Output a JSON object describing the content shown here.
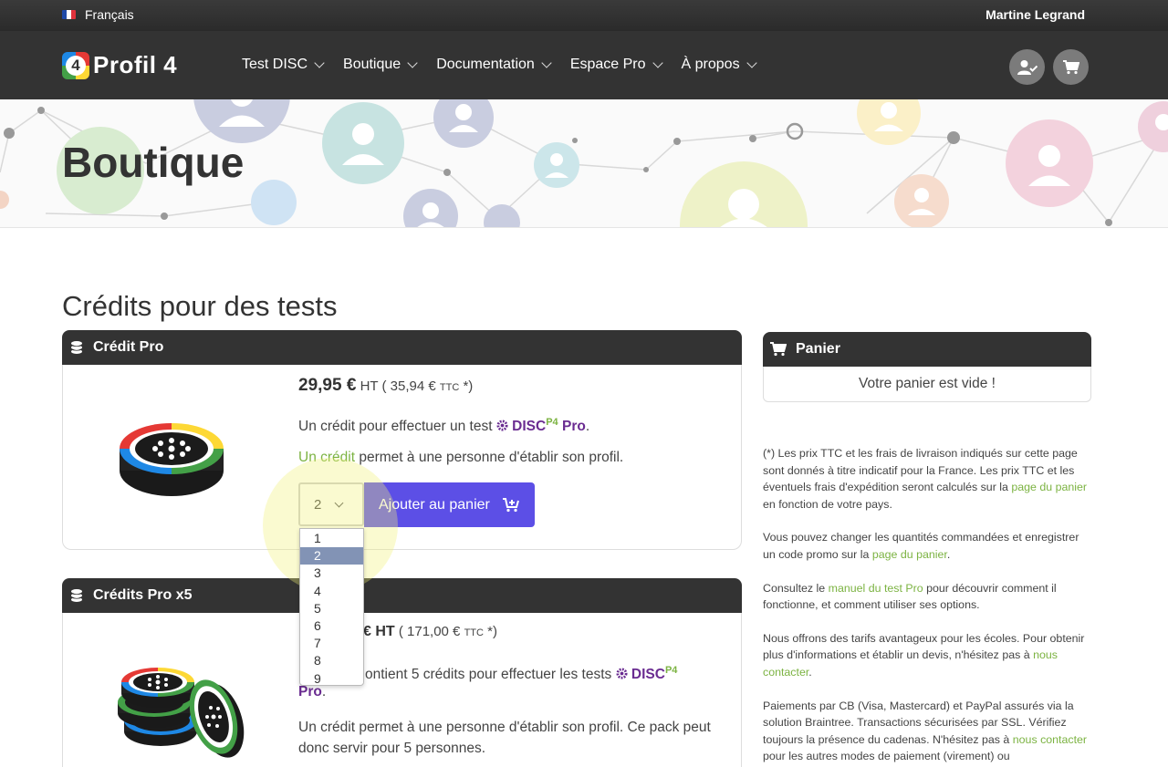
{
  "topbar": {
    "language": "Français",
    "user": "Martine Legrand"
  },
  "brand": {
    "badge": "4",
    "name": "Profil 4"
  },
  "nav": {
    "items": [
      "Test DISC",
      "Boutique",
      "Documentation",
      "Espace Pro",
      "À propos"
    ]
  },
  "hero": {
    "title": "Boutique"
  },
  "section": {
    "title": "Crédits pour des tests"
  },
  "products": [
    {
      "title": "Crédit Pro",
      "price": "29,95 €",
      "price_ht": "HT",
      "price_ttc_open": "( 35,94 €",
      "ttc": "TTC",
      "price_ttc_close": "*)",
      "desc_prefix": "Un crédit pour effectuer un test",
      "brand_disc": "DISC",
      "brand_sup": "P4",
      "brand_pro": "Pro",
      "desc_suffix": ".",
      "credit_link": "Un crédit",
      "credit_text": "permet à une personne d'établir son profil.",
      "qty_selected": "2",
      "add_label": "Ajouter au panier"
    },
    {
      "title": "Crédits Pro x5",
      "price_ht": "€ HT",
      "price_ttc_open": "( 171,00 €",
      "ttc": "TTC",
      "price_ttc_close": "*)",
      "desc_partial": "ontient 5 crédits pour effectuer les tests",
      "brand_disc": "DISC",
      "brand_sup": "P4",
      "brand_pro": "Pro",
      "desc_suffix": ".",
      "credit_text": "Un crédit permet à une personne d'établir son profil. Ce pack peut donc servir pour 5 personnes."
    }
  ],
  "dropdown": {
    "options": [
      "1",
      "2",
      "3",
      "4",
      "5",
      "6",
      "7",
      "8",
      "9"
    ],
    "selected_index": 1
  },
  "cart": {
    "title": "Panier",
    "empty_text": "Votre panier est vide !"
  },
  "notes": {
    "n1_text": "(*) Les prix TTC et les frais de livraison indiqués sur cette page sont donnés à titre indicatif pour la France. Les prix TTC et les éventuels frais d'expédition seront calculés sur la",
    "n1_link": "page du panier",
    "n1_end": "en fonction de votre pays.",
    "n2_text": "Vous pouvez changer les quantités commandées et enregistrer un code promo sur la",
    "n2_link": "page du panier",
    "n2_end": ".",
    "n3_text": "Consultez le",
    "n3_link": "manuel du test Pro",
    "n3_end": "pour découvrir comment il fonctionne, et comment utiliser ses options.",
    "n4_text": "Nous offrons des tarifs avantageux pour les écoles. Pour obtenir plus d'informations et établir un devis, n'hésitez pas à",
    "n4_link": "nous contacter",
    "n4_end": ".",
    "n5_text": "Paiements par CB (Visa, Mastercard) et PayPal assurés via la solution Braintree. Transactions sécurisées par SSL. Vérifiez toujours la présence du cadenas. N'hésitez pas à",
    "n5_link": "nous contacter",
    "n5_end": "pour les autres modes de paiement (virement) ou"
  },
  "colors": {
    "primary_button": "#5c4fe6",
    "dark_bar": "#333333",
    "link_green": "#7cb342",
    "disc_purple": "#6a2c91",
    "selected_option": "#8293b5"
  }
}
